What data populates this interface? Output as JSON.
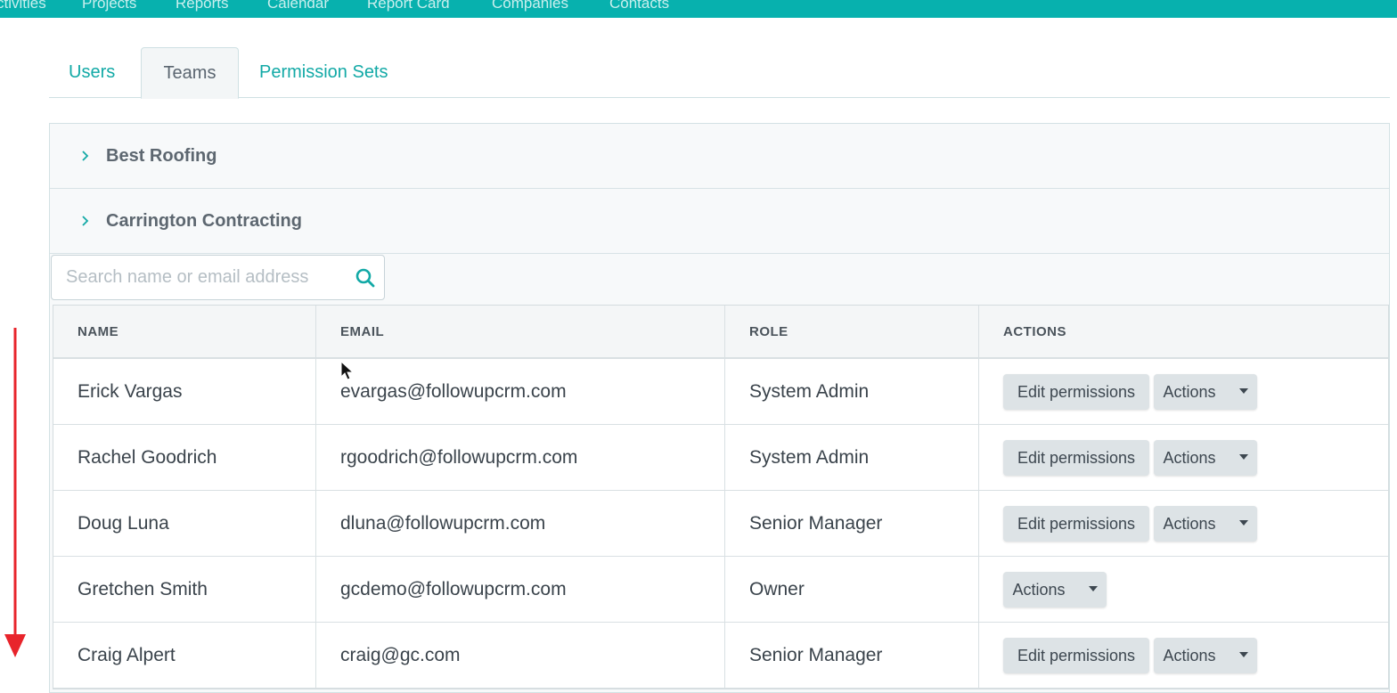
{
  "topnav": {
    "items": [
      "ctivities",
      "Projects",
      "Reports",
      "Calendar",
      "Report Card",
      "Companies",
      "Contacts"
    ]
  },
  "tabs": [
    {
      "label": "Users",
      "active": false
    },
    {
      "label": "Teams",
      "active": true
    },
    {
      "label": "Permission Sets",
      "active": false
    }
  ],
  "groups": [
    {
      "name": "Best Roofing",
      "icon": "chevron-right-icon"
    },
    {
      "name": "Carrington Contracting",
      "icon": "chevron-right-icon"
    }
  ],
  "search": {
    "placeholder": "Search name or email address",
    "value": "",
    "icon": "search-icon"
  },
  "table": {
    "columns": [
      "NAME",
      "EMAIL",
      "ROLE",
      "ACTIONS"
    ],
    "rows": [
      {
        "name": "Erick Vargas",
        "email": "evargas@followupcrm.com",
        "role": "System Admin",
        "edit_label": "Edit permissions",
        "actions_label": "Actions"
      },
      {
        "name": "Rachel Goodrich",
        "email": "rgoodrich@followupcrm.com",
        "role": "System Admin",
        "edit_label": "Edit permissions",
        "actions_label": "Actions"
      },
      {
        "name": "Doug Luna",
        "email": "dluna@followupcrm.com",
        "role": "Senior Manager",
        "edit_label": "Edit permissions",
        "actions_label": "Actions"
      },
      {
        "name": "Gretchen Smith",
        "email": "gcdemo@followupcrm.com",
        "role": "Owner",
        "edit_label": null,
        "actions_label": "Actions"
      },
      {
        "name": "Craig Alpert",
        "email": "craig@gc.com",
        "role": "Senior Manager",
        "edit_label": "Edit permissions",
        "actions_label": "Actions"
      }
    ]
  },
  "colors": {
    "accent": "#07b1ae",
    "annotation_arrow": "#e8242b"
  }
}
